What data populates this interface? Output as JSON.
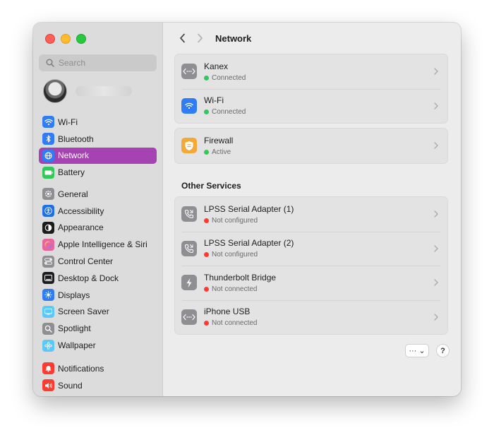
{
  "window": {
    "title": "Network"
  },
  "sidebar": {
    "search_placeholder": "Search",
    "groups": [
      [
        {
          "label": "Wi-Fi",
          "icon": "wifi-icon",
          "color": "#2f7cf6"
        },
        {
          "label": "Bluetooth",
          "icon": "bluetooth-icon",
          "color": "#2f7cf6"
        },
        {
          "label": "Network",
          "icon": "globe-icon",
          "color": "#2f7cf6",
          "active": true
        },
        {
          "label": "Battery",
          "icon": "battery-icon",
          "color": "#34c759"
        }
      ],
      [
        {
          "label": "General",
          "icon": "gear-icon",
          "color": "#8e8e93"
        },
        {
          "label": "Accessibility",
          "icon": "accessibility-icon",
          "color": "#1f6fe5"
        },
        {
          "label": "Appearance",
          "icon": "appearance-icon",
          "color": "#1c1c1e"
        },
        {
          "label": "Apple Intelligence & Siri",
          "icon": "siri-icon",
          "color": "#e7659c"
        },
        {
          "label": "Control Center",
          "icon": "control-center-icon",
          "color": "#8e8e93"
        },
        {
          "label": "Desktop & Dock",
          "icon": "dock-icon",
          "color": "#1c1c1e"
        },
        {
          "label": "Displays",
          "icon": "sun-icon",
          "color": "#2f7cf6"
        },
        {
          "label": "Screen Saver",
          "icon": "screen-saver-icon",
          "color": "#5ac8fa"
        },
        {
          "label": "Spotlight",
          "icon": "magnifier-icon",
          "color": "#8e8e93"
        },
        {
          "label": "Wallpaper",
          "icon": "flower-icon",
          "color": "#5ac8fa"
        }
      ],
      [
        {
          "label": "Notifications",
          "icon": "bell-icon",
          "color": "#ff3b30"
        },
        {
          "label": "Sound",
          "icon": "speaker-icon",
          "color": "#ff3b30"
        }
      ]
    ]
  },
  "main": {
    "title": "Network",
    "connected_services": [
      {
        "title": "Kanex",
        "status": "Connected",
        "status_color": "#34c759",
        "icon": "ethernet-icon",
        "icon_color": "#8e8e93"
      },
      {
        "title": "Wi-Fi",
        "status": "Connected",
        "status_color": "#34c759",
        "icon": "wifi-icon",
        "icon_color": "#2f7cf6"
      }
    ],
    "firewall": {
      "title": "Firewall",
      "status": "Active",
      "status_color": "#34c759",
      "icon": "firewall-icon",
      "icon_color": "#f4a836"
    },
    "other_heading": "Other Services",
    "other_services": [
      {
        "title": "LPSS Serial Adapter (1)",
        "status": "Not configured",
        "status_color": "#ff3b30",
        "icon": "phone-icon",
        "icon_color": "#8e8e93"
      },
      {
        "title": "LPSS Serial Adapter (2)",
        "status": "Not configured",
        "status_color": "#ff3b30",
        "icon": "phone-icon",
        "icon_color": "#8e8e93"
      },
      {
        "title": "Thunderbolt Bridge",
        "status": "Not connected",
        "status_color": "#ff3b30",
        "icon": "thunderbolt-icon",
        "icon_color": "#8e8e93"
      },
      {
        "title": "iPhone USB",
        "status": "Not connected",
        "status_color": "#ff3b30",
        "icon": "ethernet-icon",
        "icon_color": "#8e8e93"
      }
    ],
    "more_label": "··· ⌄",
    "help_label": "?"
  }
}
